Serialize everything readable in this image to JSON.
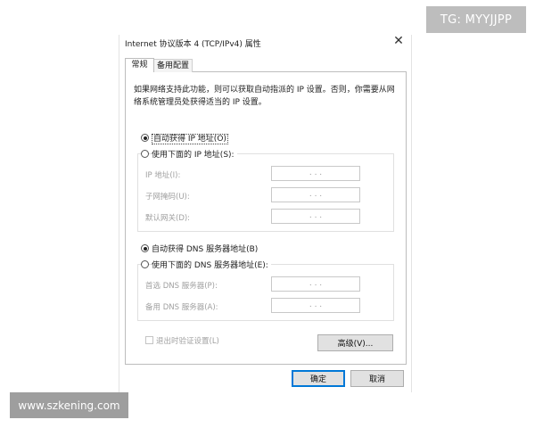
{
  "watermarks": {
    "top": "TG: MYYJJPP",
    "bottom": "www.szkening.com"
  },
  "dialog": {
    "title": "Internet 协议版本 4 (TCP/IPv4) 属性",
    "close_glyph": "✕",
    "tabs": [
      "常规",
      "备用配置"
    ],
    "description": "如果网络支持此功能，则可以获取自动指派的 IP 设置。否则，你需要从网络系统管理员处获得适当的 IP 设置。",
    "ip_section": {
      "auto_label": "自动获得 IP 地址(O)",
      "manual_label": "使用下面的 IP 地址(S):",
      "selected": "auto",
      "fields": [
        {
          "label": "IP 地址(I):",
          "value": ". . ."
        },
        {
          "label": "子网掩码(U):",
          "value": ". . ."
        },
        {
          "label": "默认网关(D):",
          "value": ". . ."
        }
      ]
    },
    "dns_section": {
      "auto_label": "自动获得 DNS 服务器地址(B)",
      "manual_label": "使用下面的 DNS 服务器地址(E):",
      "selected": "auto",
      "fields": [
        {
          "label": "首选 DNS 服务器(P):",
          "value": ". . ."
        },
        {
          "label": "备用 DNS 服务器(A):",
          "value": ". . ."
        }
      ]
    },
    "validate_label": "退出时验证设置(L)",
    "advanced_button": "高级(V)...",
    "ok_button": "确定",
    "cancel_button": "取消"
  }
}
